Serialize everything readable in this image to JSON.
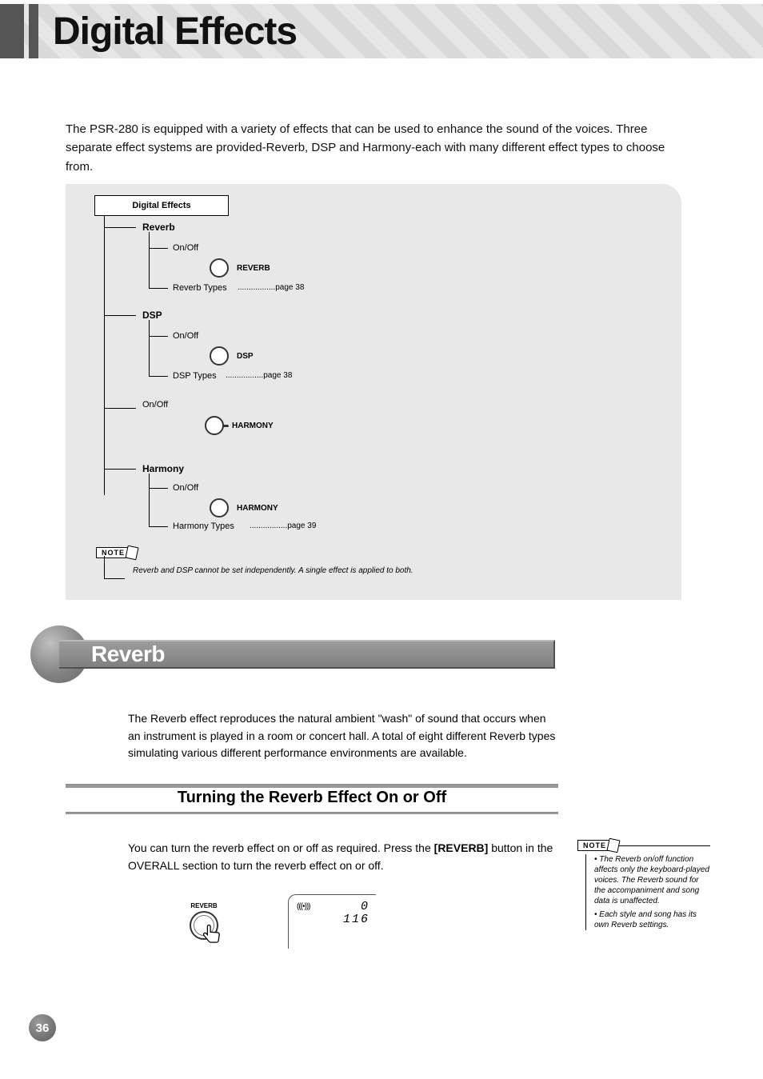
{
  "title": "Digital Effects",
  "intro": "The PSR-280 is equipped with a variety of effects that can be used to enhance the sound of the voices. Three separate effect systems are provided-Reverb, DSP and Harmony-each with many different effect types to choose from.",
  "diagram": {
    "root": "Digital Effects",
    "reverb": {
      "label": "Reverb",
      "onoff": "On/Off",
      "sw": "REVERB",
      "types_label": "Reverb Types",
      "pgref": "page 38"
    },
    "dsp": {
      "label": "DSP",
      "onoff": "On/Off",
      "sw": "DSP",
      "types_label": "DSP Types",
      "pgref": "page 38"
    },
    "harmony": {
      "label": "Harmony",
      "onoff": "On/Off",
      "sw": "HARMONY",
      "types_label": "Harmony Types",
      "pgref": "page 39"
    },
    "note_text": "Reverb and DSP cannot be set independently. A single effect is applied to both.",
    "note_tag": "NOTE"
  },
  "section": {
    "name": "Reverb",
    "desc": "The Reverb effect reproduces the natural ambient \"wash\" of sound that occurs when an instrument is played in a room or concert hall. A total of eight different Reverb types simulating various different performance environments are available.",
    "subhead": "Turning the Reverb Effect On or Off",
    "subdesc": [
      "You can turn the reverb effect on or off as required. Press the ",
      "[REVERB]",
      " button in the OVERALL section to turn the reverb effect on or off."
    ],
    "button_label": "REVERB",
    "lcd": {
      "icon_text": "(((•)))",
      "val1": "0",
      "val2": "116"
    }
  },
  "side_note": {
    "tag": "NOTE",
    "lines": [
      "• The Reverb on/off function affects only the keyboard-played voices. The Reverb sound for the accompaniment and song data is unaffected.",
      "• Each style and song has its own Reverb settings."
    ]
  },
  "page_number": "36",
  "page_sub": ""
}
